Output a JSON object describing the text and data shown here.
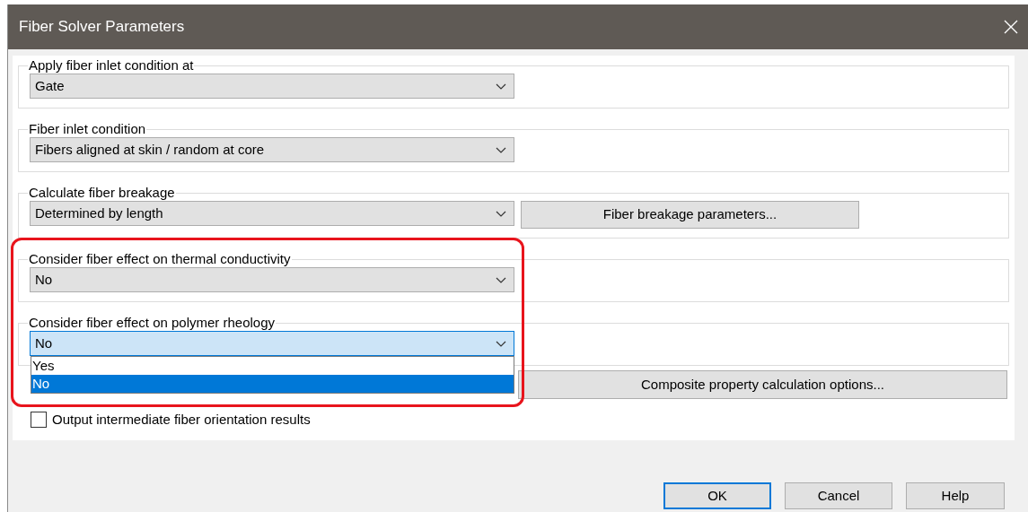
{
  "window": {
    "title": "Fiber Solver Parameters",
    "highlight_frame": true
  },
  "groups": [
    {
      "label": "Apply fiber inlet condition at",
      "dropdown": {
        "value": "Gate",
        "focused": false,
        "open": false
      }
    },
    {
      "label": "Fiber inlet condition",
      "dropdown": {
        "value": "Fibers aligned at skin / random at core",
        "focused": false,
        "open": false
      }
    },
    {
      "label": "Calculate fiber breakage",
      "dropdown": {
        "value": "Determined by length",
        "focused": false,
        "open": false
      },
      "button": "Fiber breakage parameters..."
    },
    {
      "label": "Consider fiber effect on thermal conductivity",
      "dropdown": {
        "value": "No",
        "focused": false,
        "open": false
      }
    },
    {
      "label": "Consider fiber effect on polymer rheology",
      "dropdown": {
        "value": "No",
        "focused": true,
        "open": true,
        "options": [
          {
            "label": "Yes",
            "selected": false
          },
          {
            "label": "No",
            "selected": true
          }
        ]
      }
    }
  ],
  "composite_button": "Composite property calculation options...",
  "checkbox": {
    "label": "Output intermediate fiber orientation results",
    "checked": false
  },
  "buttons": [
    {
      "label": "OK",
      "default": true
    },
    {
      "label": "Cancel",
      "default": false
    },
    {
      "label": "Help",
      "default": false
    }
  ]
}
